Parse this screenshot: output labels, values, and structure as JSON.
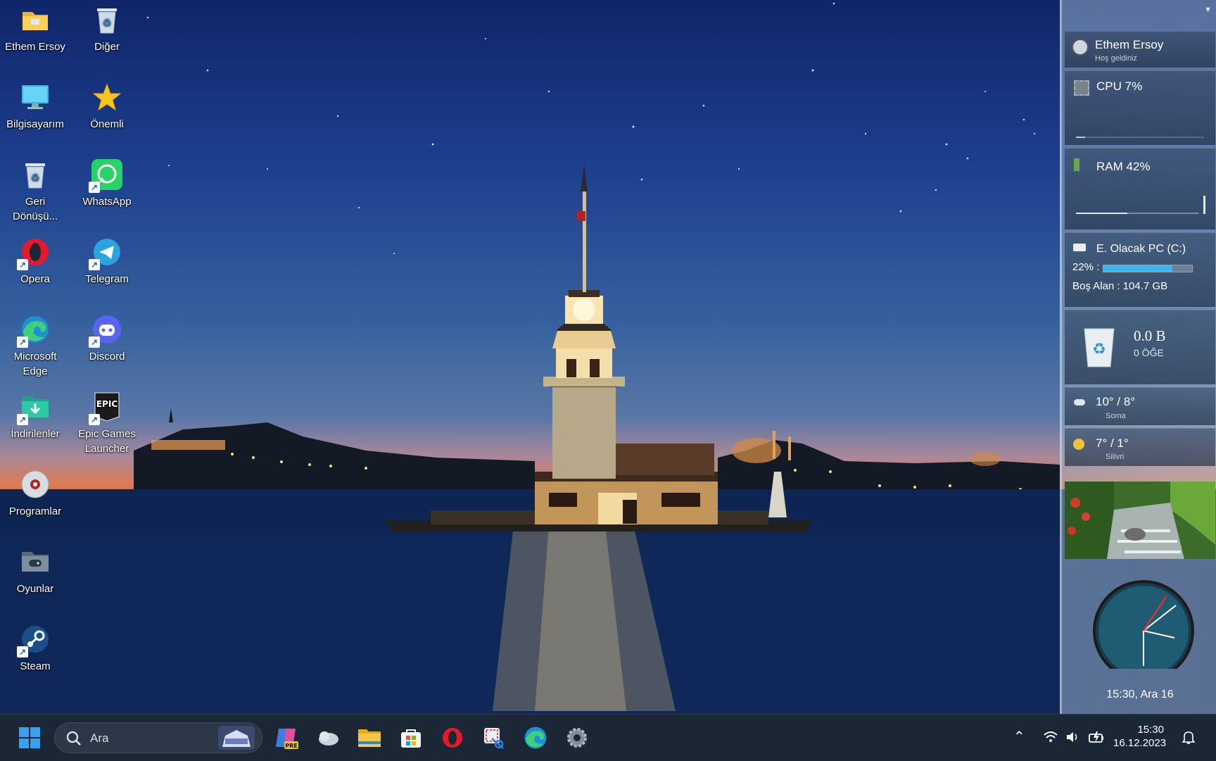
{
  "desktop": {
    "icons": [
      {
        "label": "Ethem Ersoy",
        "icon": "user-folder-icon"
      },
      {
        "label": "Diğer",
        "icon": "recycle-bin-icon"
      },
      {
        "label": "Bilgisayarım",
        "icon": "computer-icon"
      },
      {
        "label": "Önemli",
        "icon": "star-icon"
      },
      {
        "label": "Geri Dönüşü...",
        "icon": "recycle-bin-icon"
      },
      {
        "label": "WhatsApp",
        "icon": "whatsapp-icon"
      },
      {
        "label": "Opera",
        "icon": "opera-icon"
      },
      {
        "label": "Telegram",
        "icon": "telegram-icon"
      },
      {
        "label": "Microsoft Edge",
        "icon": "edge-icon"
      },
      {
        "label": "Discord",
        "icon": "discord-icon"
      },
      {
        "label": "İndirilenler",
        "icon": "downloads-folder-icon"
      },
      {
        "label": "Epic Games Launcher",
        "icon": "epic-games-icon"
      },
      {
        "label": "Programlar",
        "icon": "programs-disc-icon"
      },
      {
        "label": "Oyunlar",
        "icon": "games-folder-icon"
      },
      {
        "label": "Steam",
        "icon": "steam-icon"
      }
    ]
  },
  "sidebar": {
    "user": {
      "name": "Ethem Ersoy",
      "greeting": "Hoş geldiniz"
    },
    "cpu": {
      "label": "CPU 7%",
      "percent": 7
    },
    "ram": {
      "label": "RAM 42%",
      "percent": 42
    },
    "drive": {
      "name": "E. Olacak PC (C:)",
      "percent_label": "22% :",
      "percent": 22,
      "free": "Boş Alan : 104.7 GB"
    },
    "recycle": {
      "size": "0.0 B",
      "items": "0 ÖĞE"
    },
    "weather": [
      {
        "temp": "10° / 8°",
        "city": "Soma",
        "icon": "cloud-icon"
      },
      {
        "temp": "7° / 1°",
        "city": "Silivri",
        "icon": "sun-icon"
      }
    ],
    "clock": {
      "caption": "15:30, Ara 16"
    }
  },
  "taskbar": {
    "search_placeholder": "Ara",
    "apps": [
      "copilot-pre-icon",
      "weather-cloud-icon",
      "file-explorer-icon",
      "microsoft-store-icon",
      "opera-icon",
      "snipping-tool-icon",
      "edge-icon",
      "settings-gear-icon"
    ],
    "time": "15:30",
    "date": "16.12.2023"
  },
  "colors": {
    "drive_bar": "#38b6f0",
    "taskbar": "#1c2736",
    "accent": "#0078d4"
  }
}
